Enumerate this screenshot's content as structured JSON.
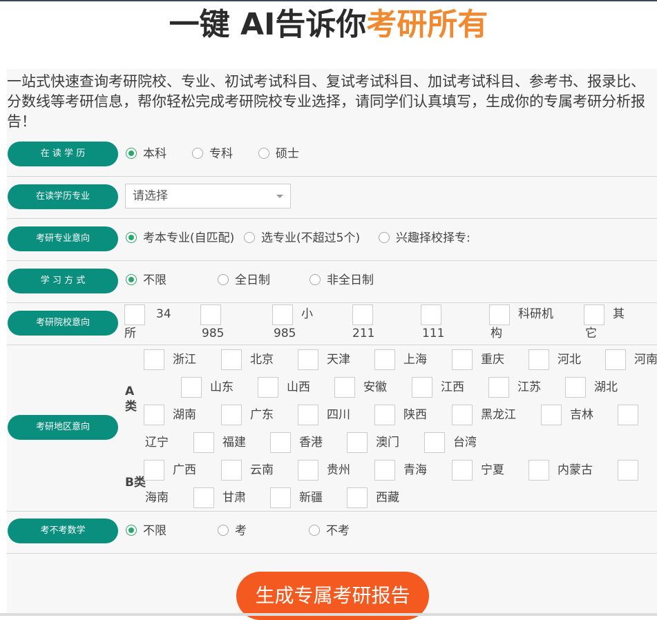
{
  "header": {
    "title_main": "一键 AI告诉你",
    "title_highlight": "考研所有"
  },
  "intro": "一站式快速查询考研院校、专业、初试考试科目、复试考试科目、加试考试科目、参考书、报录比、分数线等考研信息，帮你轻松完成考研院校专业选择，请同学们认真填写，生成你的专属考研分析报告！",
  "education": {
    "label": "在 读 学 历",
    "options": [
      "本科",
      "专科",
      "硕士"
    ],
    "selected": "本科"
  },
  "major": {
    "label": "在读学历专业",
    "placeholder": "请选择"
  },
  "intent": {
    "label": "考研专业意向",
    "options": [
      "考本专业(自匹配)",
      "选专业(不超过5个)",
      "兴趣择校择专:"
    ],
    "selected": "考本专业(自匹配)"
  },
  "study_mode": {
    "label": "学 习 方 式",
    "options": [
      "不限",
      "全日制",
      "非全日制"
    ],
    "selected": "不限"
  },
  "school_intent": {
    "label": "考研院校意向",
    "items": [
      {
        "top": "34",
        "bottom": "所"
      },
      {
        "top": "",
        "bottom": "985"
      },
      {
        "top": "小",
        "bottom": "985"
      },
      {
        "top": "",
        "bottom": "211"
      },
      {
        "top": "",
        "bottom": "111"
      },
      {
        "top": "科研机",
        "bottom": "构"
      },
      {
        "top": "其",
        "bottom": "它"
      }
    ]
  },
  "region": {
    "label": "考研地区意向",
    "group_a": "A类",
    "group_b": "B类",
    "regions_a": [
      "浙江",
      "北京",
      "天津",
      "上海",
      "重庆",
      "河北",
      "河南",
      "山东",
      "山西",
      "安徽",
      "江西",
      "江苏",
      "湖北",
      "湖南",
      "广东",
      "四川",
      "陕西",
      "黑龙江",
      "吉林",
      "辽宁",
      "福建",
      "香港",
      "澳门",
      "台湾"
    ],
    "regions_b": [
      "广西",
      "云南",
      "贵州",
      "青海",
      "宁夏",
      "内蒙古",
      "海南",
      "甘肃",
      "新疆",
      "西藏"
    ]
  },
  "math": {
    "label": "考不考数学",
    "options": [
      "不限",
      "考",
      "不考"
    ],
    "selected": "不限"
  },
  "submit_label": "生成专属考研报告",
  "colors": {
    "accent": "#0a8f7e",
    "highlight": "#f08a32",
    "submit": "#f45a1f",
    "radio_checked": "#2aa86c"
  }
}
